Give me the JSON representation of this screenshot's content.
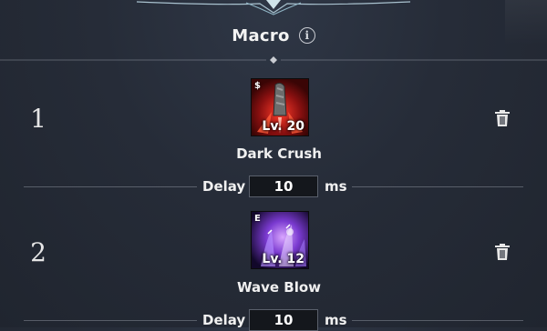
{
  "header": {
    "title": "Macro",
    "info_glyph": "i"
  },
  "delay_label": "Delay",
  "delay_unit": "ms",
  "macros": [
    {
      "index": "1",
      "skill_name": "Dark Crush",
      "level": "Lv. 20",
      "tag": "$",
      "icon": "dark-crush-skill-icon",
      "delay": "10"
    },
    {
      "index": "2",
      "skill_name": "Wave Blow",
      "level": "Lv. 12",
      "tag": "E",
      "icon": "wave-blow-skill-icon",
      "delay": "10"
    }
  ],
  "colors": {
    "dark_crush_bg": "#7a1010",
    "wave_blow_bg": "#2a1448"
  }
}
